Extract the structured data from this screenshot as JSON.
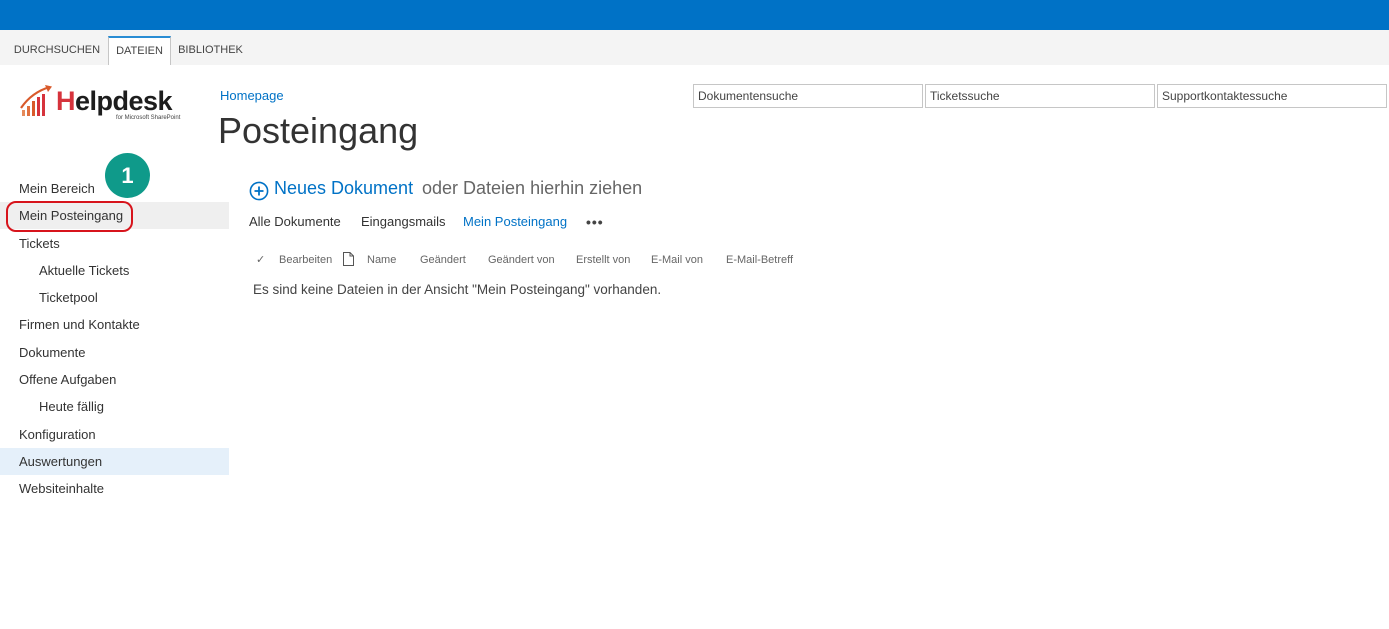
{
  "ribbon": {
    "tabs": [
      {
        "label": "DURCHSUCHEN",
        "active": false
      },
      {
        "label": "DATEIEN",
        "active": true
      },
      {
        "label": "BIBLIOTHEK",
        "active": false
      }
    ]
  },
  "logo": {
    "text_h": "H",
    "text_rest": "elpdesk",
    "subtitle": "for Microsoft SharePoint"
  },
  "breadcrumb": "Homepage",
  "page_title": "Posteingang",
  "search": {
    "documents_placeholder": "Dokumentensuche",
    "tickets_placeholder": "Ticketssuche",
    "contacts_placeholder": "Supportkontaktessuche"
  },
  "nav": {
    "items": [
      {
        "label": "Mein Bereich"
      },
      {
        "label": "Mein Posteingang"
      },
      {
        "label": "Tickets"
      },
      {
        "label": "Aktuelle Tickets"
      },
      {
        "label": "Ticketpool"
      },
      {
        "label": "Firmen und Kontakte"
      },
      {
        "label": "Dokumente"
      },
      {
        "label": "Offene Aufgaben"
      },
      {
        "label": "Heute fällig"
      },
      {
        "label": "Konfiguration"
      },
      {
        "label": "Auswertungen"
      },
      {
        "label": "Websiteinhalte"
      }
    ]
  },
  "annotation": {
    "step": "1"
  },
  "new_document": {
    "link": "Neues Dokument",
    "rest": "oder Dateien hierhin ziehen"
  },
  "views": {
    "tabs": [
      "Alle Dokumente",
      "Eingangsmails",
      "Mein Posteingang"
    ],
    "active": "Mein Posteingang",
    "more": "•••"
  },
  "columns": {
    "check": "✓",
    "headers": [
      "Bearbeiten",
      "Name",
      "Geändert",
      "Geändert von",
      "Erstellt von",
      "E-Mail von",
      "E-Mail-Betreff"
    ]
  },
  "empty_message": "Es sind keine Dateien in der Ansicht \"Mein Posteingang\" vorhanden.",
  "colors": {
    "suite_bar": "#0072c6",
    "link": "#0072c6",
    "badge": "#0f9a8a",
    "highlight_ring": "#d7141c",
    "logo_accent": "#d6333c"
  }
}
